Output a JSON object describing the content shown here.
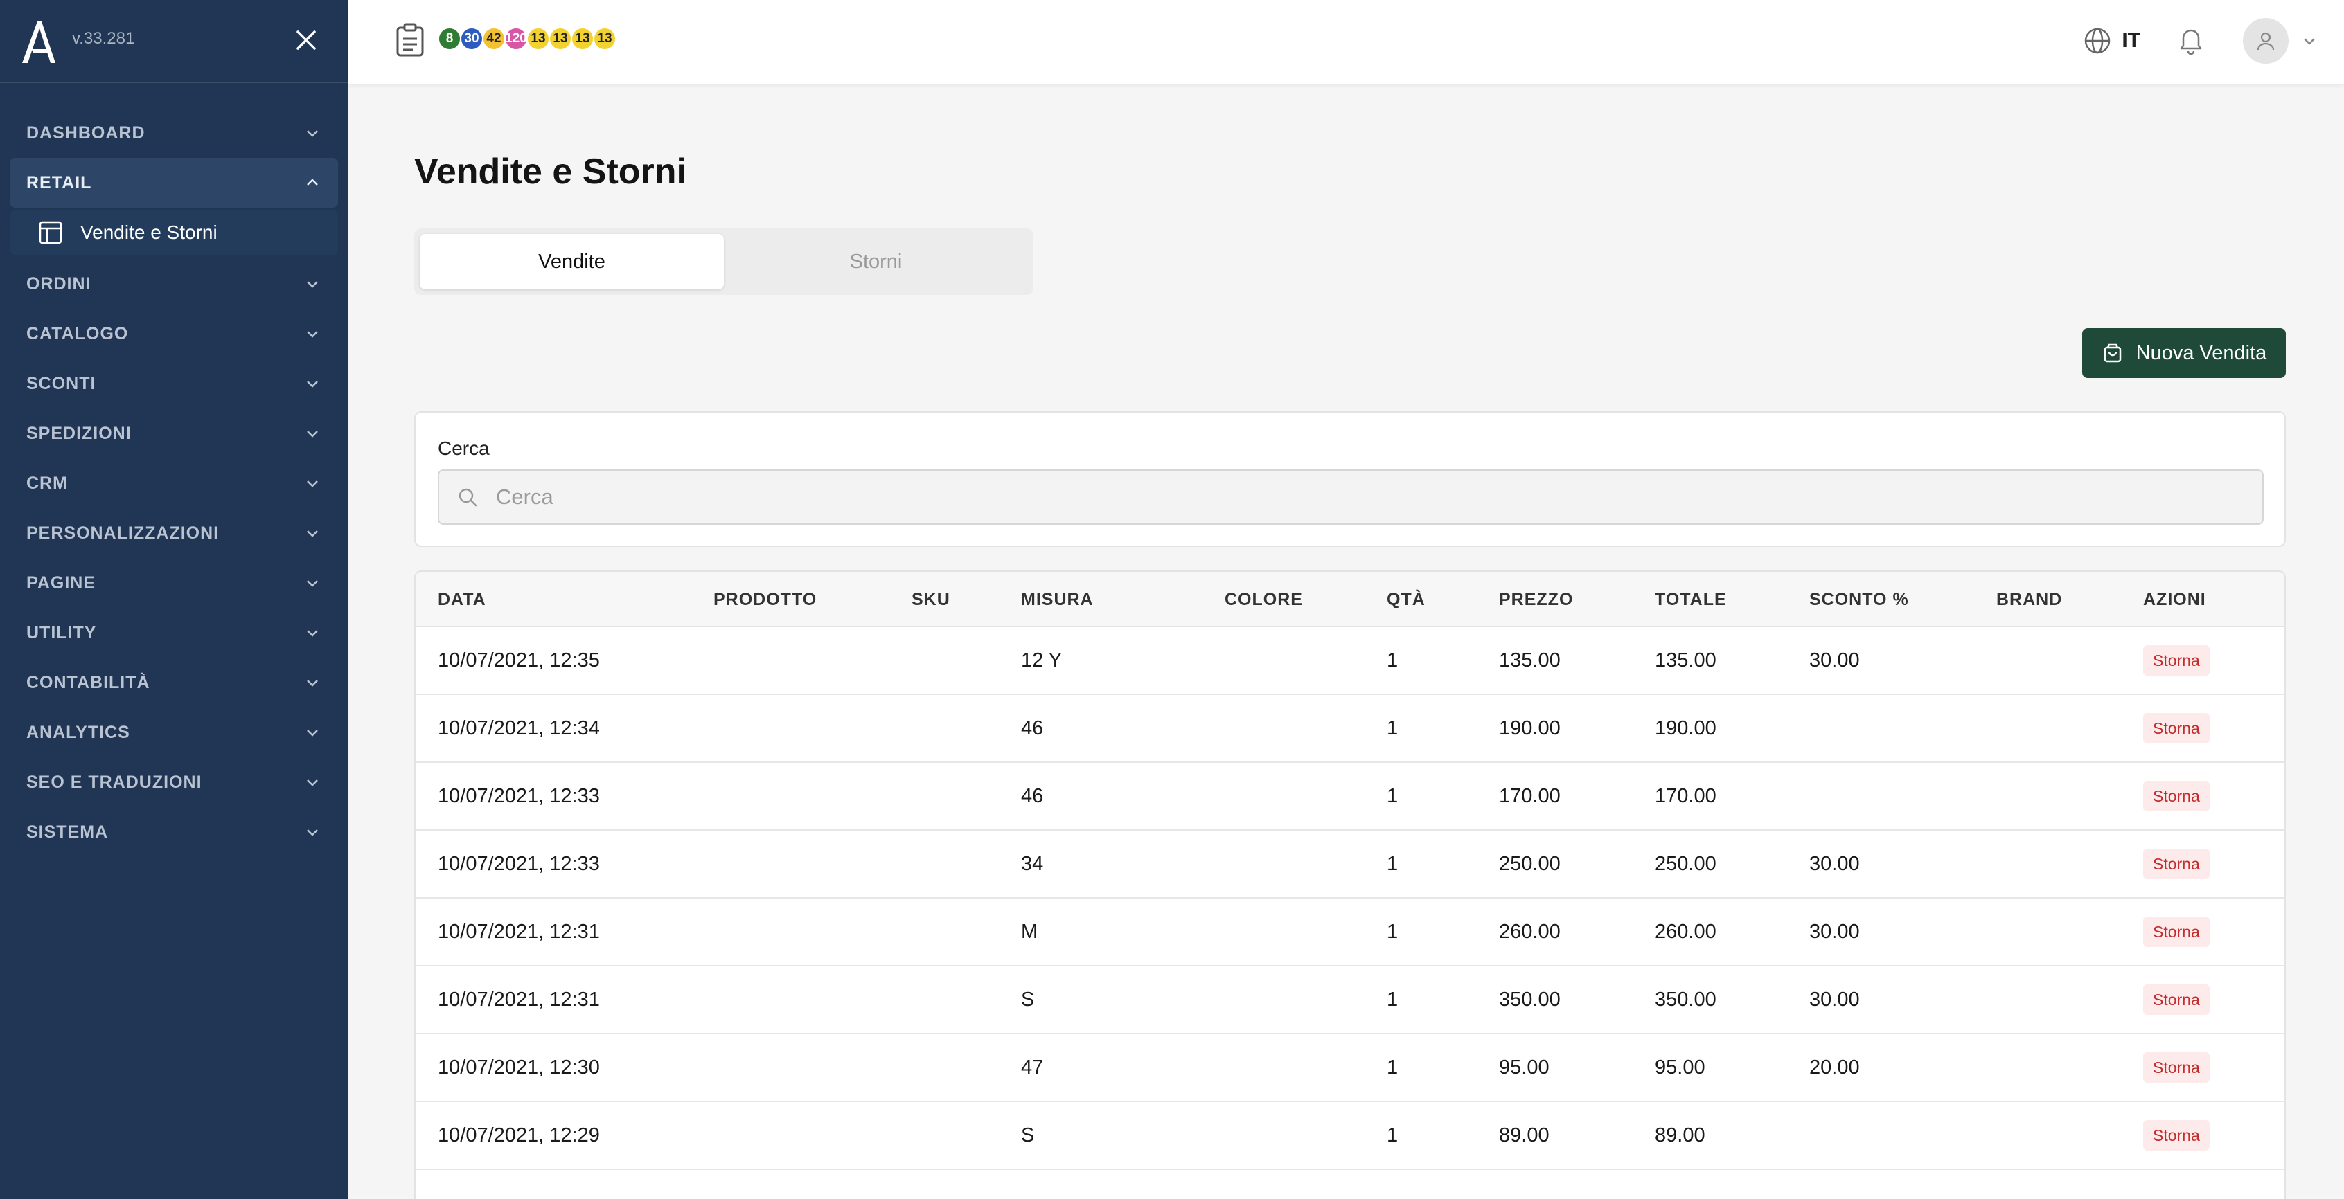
{
  "sidebar": {
    "version": "v.33.281",
    "items": [
      {
        "label": "DASHBOARD"
      },
      {
        "label": "RETAIL"
      },
      {
        "label": "ORDINI"
      },
      {
        "label": "CATALOGO"
      },
      {
        "label": "SCONTI"
      },
      {
        "label": "SPEDIZIONI"
      },
      {
        "label": "CRM"
      },
      {
        "label": "PERSONALIZZAZIONI"
      },
      {
        "label": "PAGINE"
      },
      {
        "label": "UTILITY"
      },
      {
        "label": "CONTABILITÀ"
      },
      {
        "label": "ANALYTICS"
      },
      {
        "label": "SEO E TRADUZIONI"
      },
      {
        "label": "SISTEMA"
      }
    ],
    "subitem": {
      "label": "Vendite e Storni"
    }
  },
  "topbar": {
    "badges": [
      {
        "value": "8",
        "color": "#2e7d32",
        "text_color": "#ffffff"
      },
      {
        "value": "30",
        "color": "#2e5bbf",
        "text_color": "#ffffff"
      },
      {
        "value": "42",
        "color": "#f2c230",
        "text_color": "#222222"
      },
      {
        "value": "120",
        "color": "#d956a6",
        "text_color": "#ffffff"
      },
      {
        "value": "13",
        "color": "#f2d230",
        "text_color": "#222222"
      },
      {
        "value": "13",
        "color": "#f2d230",
        "text_color": "#222222"
      },
      {
        "value": "13",
        "color": "#f2d230",
        "text_color": "#222222"
      },
      {
        "value": "13",
        "color": "#f2d230",
        "text_color": "#222222"
      }
    ],
    "language": "IT"
  },
  "page": {
    "title": "Vendite e Storni",
    "tabs": [
      {
        "label": "Vendite",
        "active": true
      },
      {
        "label": "Storni",
        "active": false
      }
    ],
    "new_button": "Nuova Vendita",
    "search": {
      "label": "Cerca",
      "placeholder": "Cerca",
      "value": ""
    }
  },
  "table": {
    "columns": [
      "DATA",
      "PRODOTTO",
      "SKU",
      "MISURA",
      "COLORE",
      "QTÀ",
      "PREZZO",
      "TOTALE",
      "SCONTO %",
      "BRAND",
      "AZIONI"
    ],
    "action_label": "Storna",
    "rows": [
      {
        "data": "10/07/2021, 12:35",
        "prodotto": "",
        "sku": "",
        "misura": "12 Y",
        "colore": "",
        "qta": "1",
        "prezzo": "135.00",
        "totale": "135.00",
        "sconto": "30.00",
        "brand": ""
      },
      {
        "data": "10/07/2021, 12:34",
        "prodotto": "",
        "sku": "",
        "misura": "46",
        "colore": "",
        "qta": "1",
        "prezzo": "190.00",
        "totale": "190.00",
        "sconto": "",
        "brand": ""
      },
      {
        "data": "10/07/2021, 12:33",
        "prodotto": "",
        "sku": "",
        "misura": "46",
        "colore": "",
        "qta": "1",
        "prezzo": "170.00",
        "totale": "170.00",
        "sconto": "",
        "brand": ""
      },
      {
        "data": "10/07/2021, 12:33",
        "prodotto": "",
        "sku": "",
        "misura": "34",
        "colore": "",
        "qta": "1",
        "prezzo": "250.00",
        "totale": "250.00",
        "sconto": "30.00",
        "brand": ""
      },
      {
        "data": "10/07/2021, 12:31",
        "prodotto": "",
        "sku": "",
        "misura": "M",
        "colore": "",
        "qta": "1",
        "prezzo": "260.00",
        "totale": "260.00",
        "sconto": "30.00",
        "brand": ""
      },
      {
        "data": "10/07/2021, 12:31",
        "prodotto": "",
        "sku": "",
        "misura": "S",
        "colore": "",
        "qta": "1",
        "prezzo": "350.00",
        "totale": "350.00",
        "sconto": "30.00",
        "brand": ""
      },
      {
        "data": "10/07/2021, 12:30",
        "prodotto": "",
        "sku": "",
        "misura": "47",
        "colore": "",
        "qta": "1",
        "prezzo": "95.00",
        "totale": "95.00",
        "sconto": "20.00",
        "brand": ""
      },
      {
        "data": "10/07/2021, 12:29",
        "prodotto": "",
        "sku": "",
        "misura": "S",
        "colore": "",
        "qta": "1",
        "prezzo": "89.00",
        "totale": "89.00",
        "sconto": "",
        "brand": ""
      }
    ]
  },
  "colors": {
    "sidebar_bg": "#213654",
    "primary_button": "#1f4a3a",
    "storna_bg": "#fdeaea",
    "storna_text": "#c42b2b"
  }
}
